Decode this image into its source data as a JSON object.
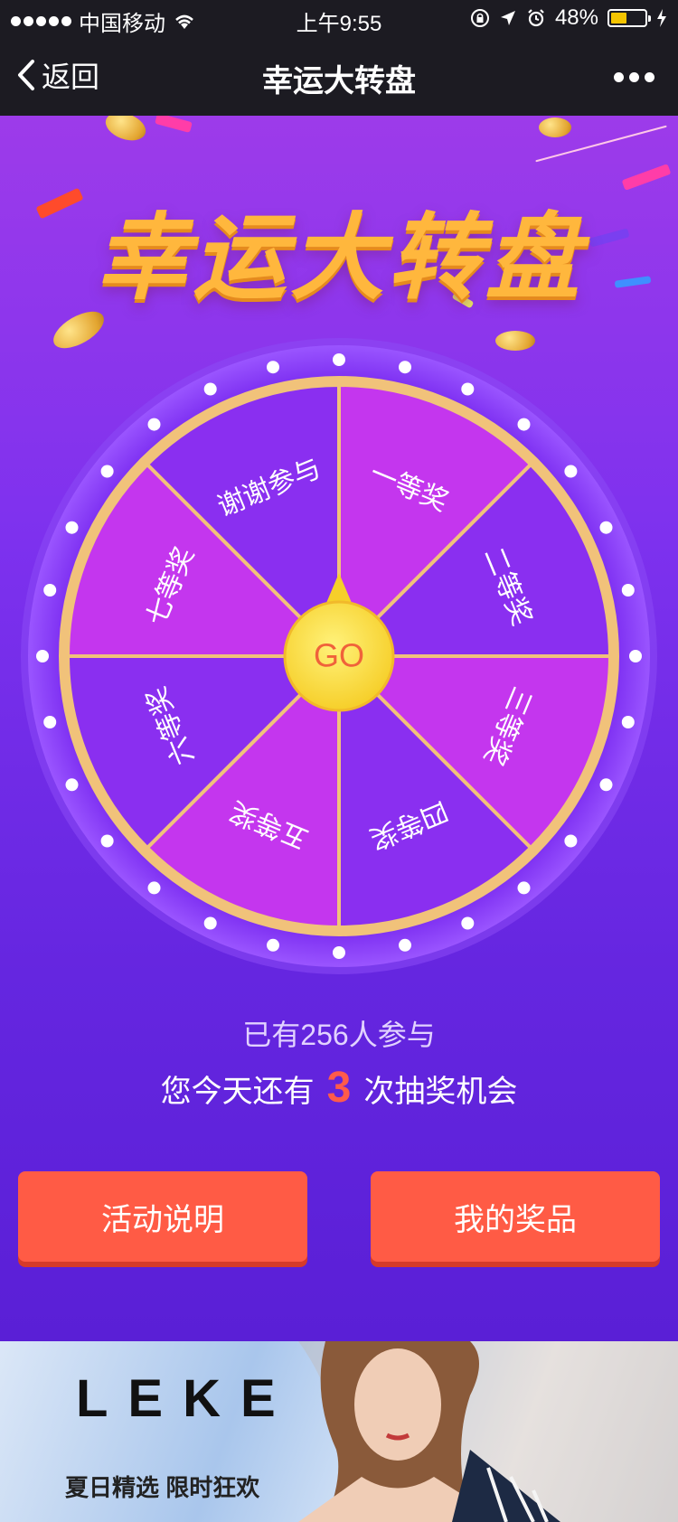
{
  "status_bar": {
    "carrier": "中国移动",
    "time": "上午9:55",
    "battery": "48%",
    "battery_level": 0.48
  },
  "nav": {
    "back_label": "返回",
    "title": "幸运大转盘"
  },
  "headline": "幸运大转盘",
  "wheel": {
    "center_label": "GO",
    "segments": [
      {
        "label": "一等奖",
        "color": "#c436ee"
      },
      {
        "label": "二等奖",
        "color": "#8a2ff0"
      },
      {
        "label": "三等奖",
        "color": "#c436ee"
      },
      {
        "label": "四等奖",
        "color": "#8a2ff0"
      },
      {
        "label": "五等奖",
        "color": "#c436ee"
      },
      {
        "label": "六等奖",
        "color": "#8a2ff0"
      },
      {
        "label": "七等奖",
        "color": "#c436ee"
      },
      {
        "label": "谢谢参与",
        "color": "#8a2ff0"
      }
    ]
  },
  "stats": {
    "participants": "已有256人参与",
    "chances_prefix": "您今天还有",
    "chances_count": "3",
    "chances_suffix": "次抽奖机会"
  },
  "buttons": {
    "rules": "活动说明",
    "prizes": "我的奖品"
  },
  "banner": {
    "logo": "LEKE",
    "slogan": "夏日精选 限时狂欢"
  },
  "colors": {
    "accent": "#ff5b45",
    "headline": "#ffb73d",
    "wheel_rim": "#f1c27a",
    "go_button": "#fbe14a"
  }
}
